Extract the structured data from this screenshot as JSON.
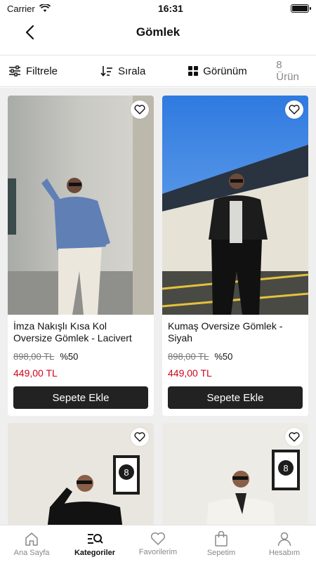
{
  "status": {
    "carrier": "Carrier",
    "time": "16:31"
  },
  "header": {
    "title": "Gömlek"
  },
  "toolbar": {
    "filter": "Filtrele",
    "sort": "Sırala",
    "view": "Görünüm",
    "count": "8 Ürün"
  },
  "products": [
    {
      "name": "İmza Nakışlı Kısa Kol Oversize Gömlek - Lacivert",
      "old_price": "898,00 TL",
      "discount": "%50",
      "price": "449,00 TL",
      "button": "Sepete Ekle"
    },
    {
      "name": "Kumaş Oversize Gömlek - Siyah",
      "old_price": "898,00 TL",
      "discount": "%50",
      "price": "449,00 TL",
      "button": "Sepete Ekle"
    },
    {
      "name": "",
      "old_price": "",
      "discount": "",
      "price": "",
      "button": ""
    },
    {
      "name": "",
      "old_price": "",
      "discount": "",
      "price": "",
      "button": ""
    }
  ],
  "nav": [
    {
      "label": "Ana Sayfa",
      "icon": "home-icon"
    },
    {
      "label": "Kategoriler",
      "icon": "category-search-icon"
    },
    {
      "label": "Favorilerim",
      "icon": "heart-icon"
    },
    {
      "label": "Sepetim",
      "icon": "bag-icon"
    },
    {
      "label": "Hesabım",
      "icon": "user-icon"
    }
  ],
  "colors": {
    "accent": "#d0021b",
    "button": "#222222",
    "grid_bg": "#efefef"
  }
}
